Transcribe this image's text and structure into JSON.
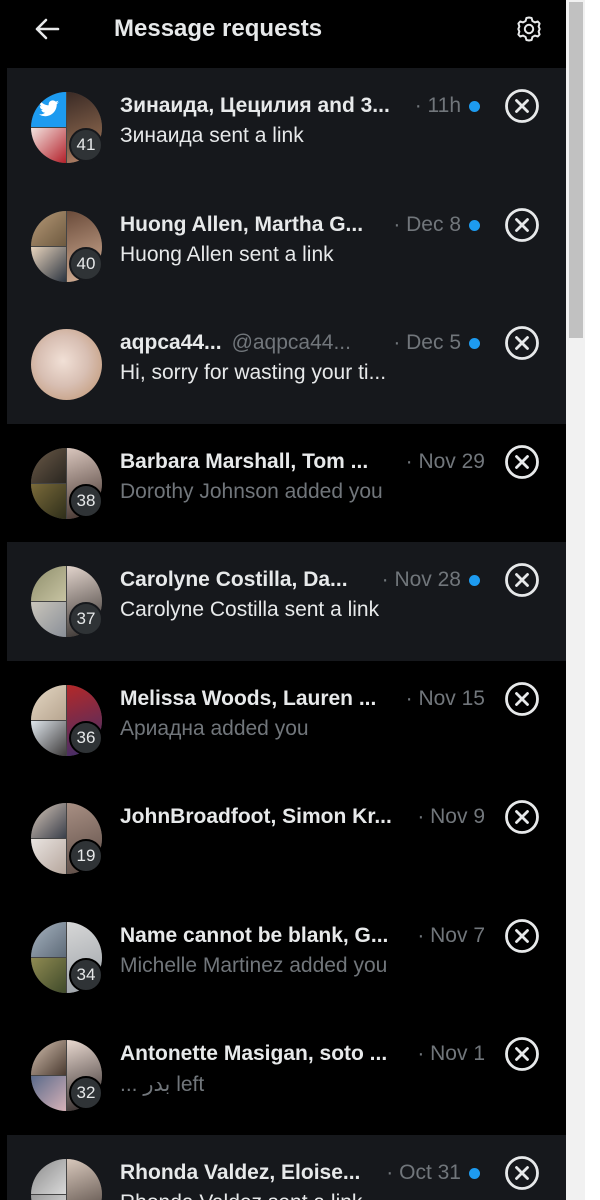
{
  "header": {
    "title": "Message requests"
  },
  "colors": {
    "unread_bg": "#16181c",
    "accent": "#1d9bf0",
    "muted": "#71767b"
  },
  "icons": {
    "back": "back-arrow-icon",
    "settings": "gear-icon",
    "dismiss": "close-circle-icon"
  },
  "requests": [
    {
      "names": "Зинаида, Цецилия and 3...",
      "handle": "",
      "date": "· 11h",
      "unread": true,
      "preview": "Зинаида sent a link",
      "count": "41"
    },
    {
      "names": "Huong Allen, Martha G...",
      "handle": "",
      "date": "· Dec 8",
      "unread": true,
      "preview": "Huong Allen sent a link",
      "count": "40"
    },
    {
      "names": "aqpca44...",
      "handle": "@aqpca44...",
      "date": "· Dec 5",
      "unread": true,
      "preview": "Hi, sorry for wasting your ti...",
      "count": ""
    },
    {
      "names": "Barbara Marshall, Tom ...",
      "handle": "",
      "date": "· Nov 29",
      "unread": false,
      "preview": "Dorothy Johnson added you",
      "count": "38"
    },
    {
      "names": "Carolyne Costilla, Da...",
      "handle": "",
      "date": "· Nov 28",
      "unread": true,
      "preview": "Carolyne Costilla sent a link",
      "count": "37"
    },
    {
      "names": "Melissa Woods, Lauren ...",
      "handle": "",
      "date": "· Nov 15",
      "unread": false,
      "preview": "Ариадна added you",
      "count": "36"
    },
    {
      "names": "JohnBroadfoot, Simon Kr...",
      "handle": "",
      "date": "· Nov 9",
      "unread": false,
      "preview": "",
      "count": "19"
    },
    {
      "names": "Name cannot be blank, G...",
      "handle": "",
      "date": "· Nov 7",
      "unread": false,
      "preview": "Michelle Martinez added you",
      "count": "34"
    },
    {
      "names": "Antonette Masigan, soto ...",
      "handle": "",
      "date": "· Nov 1",
      "unread": false,
      "preview": "... بدر left",
      "count": "32"
    },
    {
      "names": "Rhonda Valdez, Eloise...",
      "handle": "",
      "date": "· Oct 31",
      "unread": true,
      "preview": "Rhonda Valdez sent a link",
      "count": ""
    }
  ]
}
